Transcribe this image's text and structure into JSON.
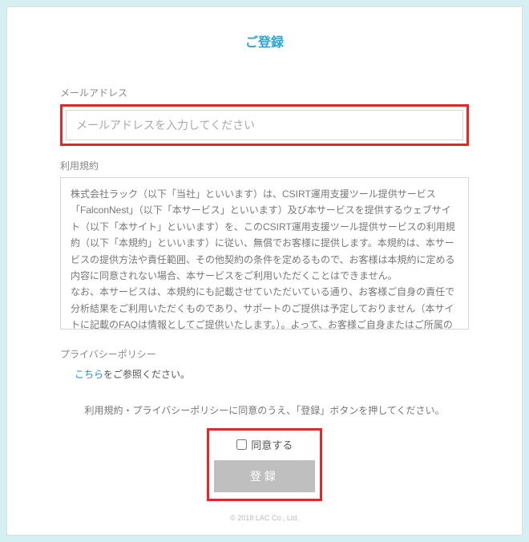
{
  "title": "ご登録",
  "email": {
    "label": "メールアドレス",
    "placeholder": "メールアドレスを入力してください"
  },
  "terms": {
    "label": "利用規約",
    "text": "株式会社ラック（以下「当社」といいます）は、CSIRT運用支援ツール提供サービス「FalconNest」（以下「本サービス」といいます）及び本サービスを提供するウェブサイト（以下「本サイト」といいます）を、このCSIRT運用支援ツール提供サービスの利用規約（以下「本規約」といいます）に従い、無償でお客様に提供します。本規約は、本サービスの提供方法や責任範囲、その他契約の条件を定めるもので、お客様は本規約に定める内容に同意されない場合、本サービスをご利用いただくことはできません。\nなお、本サービスは、本規約にも記載させていただいている通り、お客様ご自身の責任で分析結果をご利用いただくものであり、サポートのご提供は予定しておりません（本サイトに記載のFAQは情報としてご提供いたします。）。よって、お客様ご自身またはご所属の組織の専門の方（情報システム部門の方など）により、本サービスによる分析結果のご判断・ご対応をいただくことを前提としております点ご了解ください。\n\n"
  },
  "privacy": {
    "label": "プライバシーポリシー",
    "link_text": "こちら",
    "after_text": "をご参照ください。"
  },
  "consent_note": "利用規約・プライバシーポリシーに同意のうえ、「登録」ボタンを押してください。",
  "agree": {
    "label": "同意する"
  },
  "register_button": "登録",
  "footer": "© 2018 LAC Co., Ltd."
}
